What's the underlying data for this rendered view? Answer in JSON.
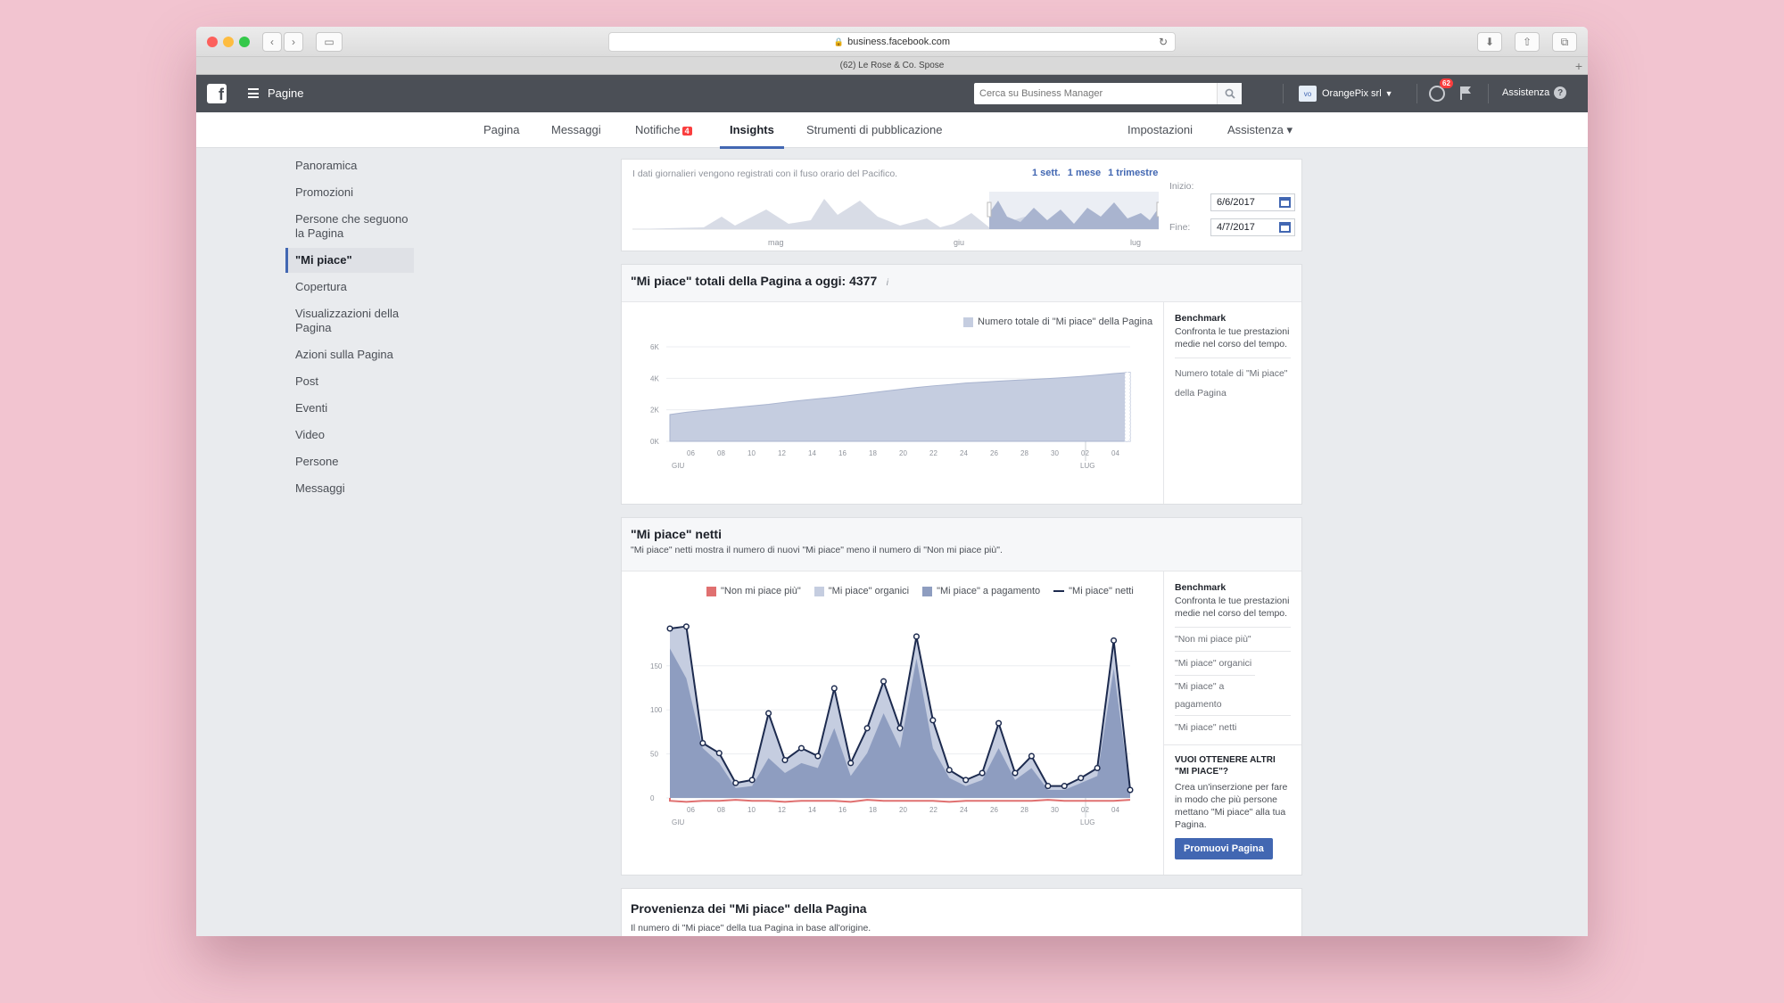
{
  "browser": {
    "url": "business.facebook.com",
    "tab_title": "(62) Le Rose & Co. Spose"
  },
  "header": {
    "logo": "f",
    "pages_label": "Pagine",
    "search_placeholder": "Cerca su Business Manager",
    "account_avatar": "vo",
    "account_name": "OrangePix srl",
    "notifications_count": "62",
    "help_label": "Assistenza",
    "help_icon": "?"
  },
  "page_tabs": {
    "pagina": "Pagina",
    "messaggi": "Messaggi",
    "notifiche": "Notifiche",
    "notifiche_badge": "4",
    "insights": "Insights",
    "strumenti": "Strumenti di pubblicazione",
    "impostazioni": "Impostazioni",
    "assistenza": "Assistenza ▾"
  },
  "sidebar": {
    "items": [
      {
        "label": "Panoramica"
      },
      {
        "label": "Promozioni"
      },
      {
        "label": "Persone che seguono la Pagina"
      },
      {
        "label": "\"Mi piace\""
      },
      {
        "label": "Copertura"
      },
      {
        "label": "Visualizzazioni della Pagina"
      },
      {
        "label": "Azioni sulla Pagina"
      },
      {
        "label": "Post"
      },
      {
        "label": "Eventi"
      },
      {
        "label": "Video"
      },
      {
        "label": "Persone"
      },
      {
        "label": "Messaggi"
      }
    ]
  },
  "range": {
    "note": "I dati giornalieri vengono registrati con il fuso orario del Pacifico.",
    "presets": [
      "1 sett.",
      "1 mese",
      "1 trimestre"
    ],
    "start_label": "Inizio:",
    "start_value": "6/6/2017",
    "end_label": "Fine:",
    "end_value": "4/7/2017",
    "month_labels": [
      "mag",
      "giu",
      "lug"
    ]
  },
  "total_likes": {
    "title": "\"Mi piace\" totali della Pagina a oggi: 4377",
    "info_icon": "i",
    "legend": "Numero totale di \"Mi piace\" della Pagina",
    "benchmark_title": "Benchmark",
    "benchmark_text": "Confronta le tue prestazioni medie nel corso del tempo.",
    "benchmark_rows": [
      "Numero totale di \"Mi piace\" della Pagina"
    ],
    "month_start": "GIU",
    "month_end": "LUG"
  },
  "net_likes": {
    "title": "\"Mi piace\" netti",
    "subtitle": "\"Mi piace\" netti mostra il numero di nuovi \"Mi piace\" meno il numero di \"Non mi piace più\".",
    "legend": [
      "\"Non mi piace più\"",
      "\"Mi piace\" organici",
      "\"Mi piace\" a pagamento",
      "\"Mi piace\" netti"
    ],
    "benchmark_title": "Benchmark",
    "benchmark_text": "Confronta le tue prestazioni medie nel corso del tempo.",
    "benchmark_rows": [
      "\"Non mi piace più\"",
      "\"Mi piace\" organici",
      "\"Mi piace\" a pagamento",
      "\"Mi piace\" netti"
    ],
    "promo_title": "VUOI OTTENERE ALTRI \"MI PIACE\"?",
    "promo_text": "Crea un'inserzione per fare in modo che più persone mettano \"Mi piace\" alla tua Pagina.",
    "promo_button": "Promuovi Pagina",
    "month_start": "GIU",
    "month_end": "LUG"
  },
  "provenance": {
    "title": "Provenienza dei \"Mi piace\" della Pagina",
    "subtitle": "Il numero di \"Mi piace\" della tua Pagina in base all'origine."
  },
  "colors": {
    "fb_blue": "#4267b2",
    "header_gray": "#4b4f56",
    "area_fill": "#c5cde0",
    "paid_fill": "#8e9dc0",
    "unlike_red": "#e07070",
    "net_line": "#1d2b4f"
  },
  "chart_data": [
    {
      "type": "area",
      "title": "\"Mi piace\" totali della Pagina a oggi: 4377",
      "legend": [
        "Numero totale di \"Mi piace\" della Pagina"
      ],
      "y_ticks": [
        "0K",
        "2K",
        "4K",
        "6K"
      ],
      "ylim": [
        0,
        6000
      ],
      "x_ticks": [
        "06",
        "08",
        "10",
        "12",
        "14",
        "16",
        "18",
        "20",
        "22",
        "24",
        "26",
        "28",
        "30",
        "02",
        "04"
      ],
      "x_days": [
        "06/06",
        "07/06",
        "08/06",
        "09/06",
        "10/06",
        "11/06",
        "12/06",
        "13/06",
        "14/06",
        "15/06",
        "16/06",
        "17/06",
        "18/06",
        "19/06",
        "20/06",
        "21/06",
        "22/06",
        "23/06",
        "24/06",
        "25/06",
        "26/06",
        "27/06",
        "28/06",
        "29/06",
        "30/06",
        "01/07",
        "02/07",
        "03/07",
        "04/07"
      ],
      "series": [
        {
          "name": "Numero totale di \"Mi piace\" della Pagina",
          "values": [
            1700,
            1850,
            1950,
            2050,
            2150,
            2250,
            2350,
            2480,
            2600,
            2700,
            2800,
            2920,
            3050,
            3180,
            3300,
            3420,
            3520,
            3600,
            3700,
            3760,
            3820,
            3880,
            3930,
            3980,
            4050,
            4120,
            4200,
            4300,
            4377
          ]
        }
      ],
      "grid": true
    },
    {
      "type": "area",
      "title": "\"Mi piace\" netti",
      "legend": [
        "\"Non mi piace più\"",
        "\"Mi piace\" organici",
        "\"Mi piace\" a pagamento",
        "\"Mi piace\" netti"
      ],
      "y_ticks": [
        "0",
        "50",
        "100",
        "150"
      ],
      "ylim": [
        0,
        170
      ],
      "x_ticks": [
        "06",
        "08",
        "10",
        "12",
        "14",
        "16",
        "18",
        "20",
        "22",
        "24",
        "26",
        "28",
        "30",
        "02",
        "04"
      ],
      "x_days": [
        "06/06",
        "07/06",
        "08/06",
        "09/06",
        "10/06",
        "11/06",
        "12/06",
        "13/06",
        "14/06",
        "15/06",
        "16/06",
        "17/06",
        "18/06",
        "19/06",
        "20/06",
        "21/06",
        "22/06",
        "23/06",
        "24/06",
        "25/06",
        "26/06",
        "27/06",
        "28/06",
        "29/06",
        "30/06",
        "01/07",
        "02/07",
        "03/07",
        "04/07"
      ],
      "series": [
        {
          "name": "\"Non mi piace più\"",
          "values": [
            -2,
            -3,
            -2,
            -2,
            -1,
            -2,
            -2,
            -3,
            -2,
            -2,
            -2,
            -3,
            -1,
            -2,
            -2,
            -2,
            -2,
            -3,
            -2,
            -2,
            -2,
            -2,
            -2,
            -1,
            -2,
            -2,
            -2,
            -2,
            -1
          ]
        },
        {
          "name": "\"Mi piace\" organici",
          "values": [
            170,
            170,
            55,
            45,
            15,
            18,
            85,
            38,
            50,
            42,
            110,
            35,
            70,
            117,
            70,
            162,
            78,
            28,
            18,
            25,
            75,
            25,
            42,
            12,
            12,
            20,
            30,
            158,
            8
          ]
        },
        {
          "name": "\"Mi piace\" a pagamento",
          "values": [
            150,
            120,
            50,
            35,
            10,
            12,
            40,
            25,
            35,
            30,
            70,
            22,
            45,
            85,
            50,
            140,
            50,
            20,
            12,
            18,
            50,
            18,
            30,
            8,
            8,
            15,
            22,
            130,
            5
          ]
        },
        {
          "name": "\"Mi piace\" netti",
          "values": [
            170,
            172,
            55,
            45,
            15,
            18,
            85,
            38,
            50,
            42,
            110,
            35,
            70,
            117,
            70,
            162,
            78,
            28,
            18,
            25,
            75,
            25,
            42,
            12,
            12,
            20,
            30,
            158,
            8
          ]
        }
      ],
      "grid": true
    }
  ]
}
